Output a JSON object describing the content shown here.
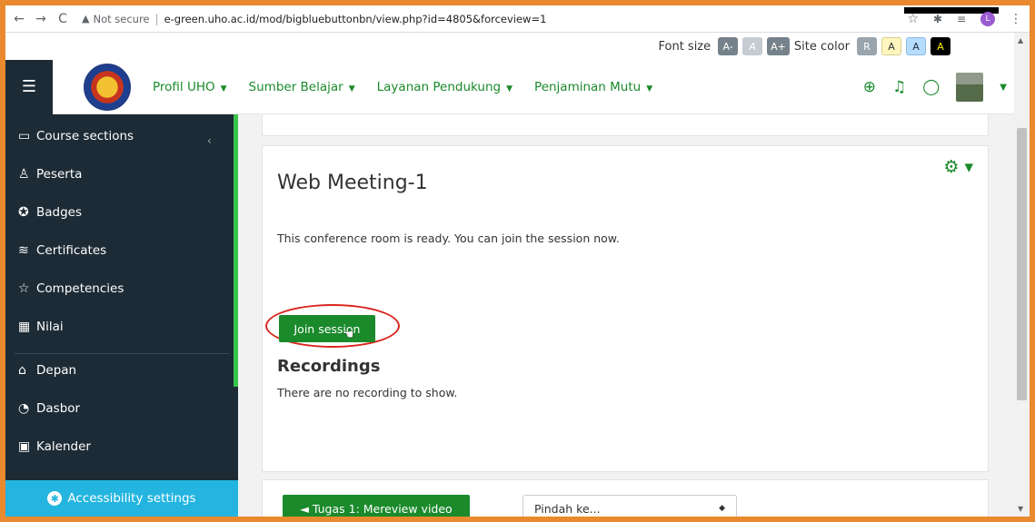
{
  "browser": {
    "back": "←",
    "forward": "→",
    "reload": "C",
    "warning_icon": "▲",
    "not_secure": "Not secure",
    "separator": "|",
    "url": "e-green.uho.ac.id/mod/bigbluebuttonbn/view.php?id=4805&forceview=1",
    "profile_letter": "L"
  },
  "a11y_toolbar": {
    "font_size_label": "Font size",
    "font_buttons": [
      "A-",
      "A",
      "A+"
    ],
    "site_color_label": "Site color",
    "color_buttons": [
      "R",
      "A",
      "A",
      "A"
    ]
  },
  "navbar": {
    "menu": [
      {
        "label": "Profil UHO"
      },
      {
        "label": "Sumber Belajar"
      },
      {
        "label": "Layanan Pendukung"
      },
      {
        "label": "Penjaminan Mutu"
      }
    ],
    "icons": [
      "globe-icon",
      "bell-icon",
      "chat-icon"
    ]
  },
  "sidebar": {
    "items": [
      {
        "label": "Course sections",
        "icon": "folder-icon",
        "glyph": "▭"
      },
      {
        "label": "Peserta",
        "icon": "users-icon",
        "glyph": "♙"
      },
      {
        "label": "Badges",
        "icon": "badge-icon",
        "glyph": "✪"
      },
      {
        "label": "Certificates",
        "icon": "certificate-icon",
        "glyph": "≋"
      },
      {
        "label": "Competencies",
        "icon": "star-icon",
        "glyph": "☆"
      },
      {
        "label": "Nilai",
        "icon": "gradebook-icon",
        "glyph": "▦"
      },
      {
        "label": "Depan",
        "icon": "home-icon",
        "glyph": "⌂"
      },
      {
        "label": "Dasbor",
        "icon": "dashboard-icon",
        "glyph": "◔"
      },
      {
        "label": "Kalender",
        "icon": "calendar-icon",
        "glyph": "▣"
      }
    ],
    "accessibility_settings": "Accessibility settings"
  },
  "main": {
    "title": "Web Meeting-1",
    "message": "This conference room is ready. You can join the session now.",
    "join_button": "Join session",
    "recordings_title": "Recordings",
    "recordings_message": "There are no recording to show.",
    "prev_activity": "◄ Tugas 1: Mereview video",
    "jump_to_placeholder": "Pindah ke..."
  },
  "colors": {
    "brand_green": "#1a8a2b",
    "sidebar_bg": "#1d2b36",
    "accessibility_blue": "#23b5e0",
    "frame_orange": "#e98a2e",
    "highlight_red": "#d9251d"
  }
}
